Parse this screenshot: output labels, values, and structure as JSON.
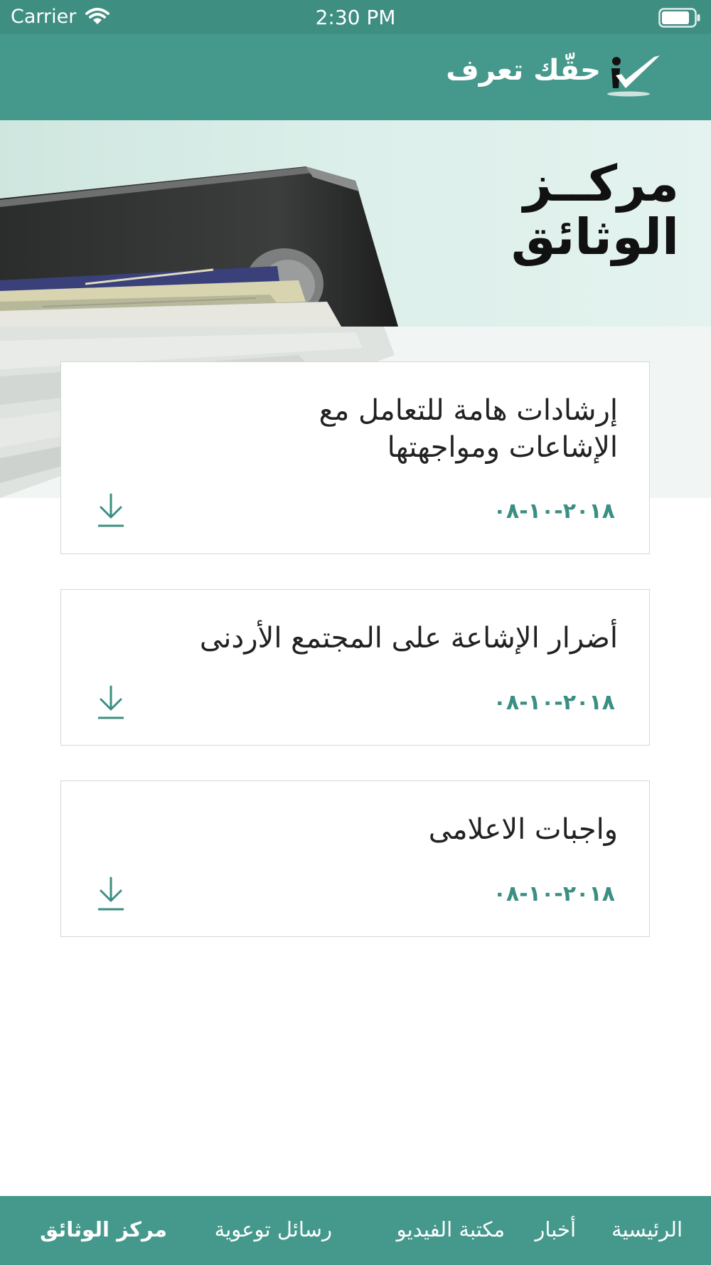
{
  "status_bar": {
    "carrier": "Carrier",
    "time": "2:30 PM"
  },
  "header": {
    "app_title": "حقّك تعرف",
    "logo_icon": "checkmark-person-logo-icon"
  },
  "hero": {
    "title_line1": "مركــز",
    "title_line2": "الوثائق"
  },
  "documents": [
    {
      "title_line1": "إرشادات هامة  للتعامل مع",
      "title_line2": "الإشاعات ومواجهتها",
      "date": "٢٠١٨-١٠-٠٨",
      "icon": "download-icon"
    },
    {
      "title_line1": "أضرار الإشاعة على المجتمع الأردنى",
      "title_line2": "",
      "date": "٢٠١٨-١٠-٠٨",
      "icon": "download-icon"
    },
    {
      "title_line1": "واجبات الاعلامى",
      "title_line2": "",
      "date": "٢٠١٨-١٠-٠٨",
      "icon": "download-icon"
    }
  ],
  "tab_bar": {
    "items": [
      {
        "label": "الرئيسية",
        "active": false
      },
      {
        "label": "أخبار",
        "active": false
      },
      {
        "label": "مكتبة الفيديو",
        "active": false
      },
      {
        "label": "رسائل توعوية",
        "active": false
      },
      {
        "label": "مركز الوثائق",
        "active": true
      }
    ]
  },
  "colors": {
    "primary": "#45998c",
    "status_bar": "#3f8e82",
    "date_accent": "#3a8f83",
    "card_border": "#d4d8d6"
  }
}
